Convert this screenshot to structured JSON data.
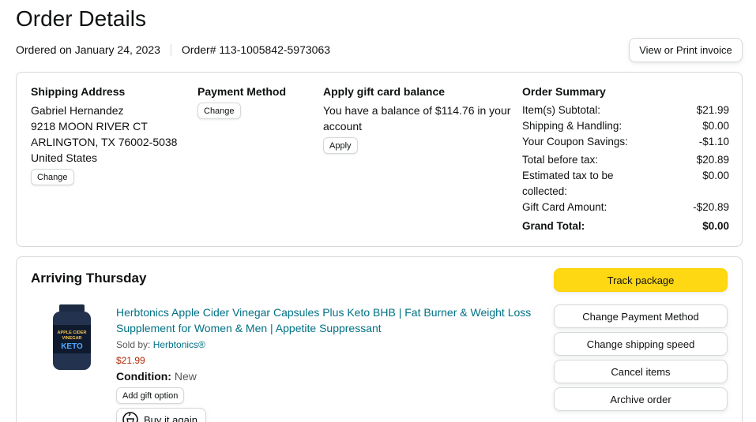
{
  "header": {
    "title": "Order Details",
    "ordered_on": "Ordered on January 24, 2023",
    "order_number": "Order# 113-1005842-5973063",
    "invoice_button": "View or Print invoice"
  },
  "shipping": {
    "heading": "Shipping Address",
    "lines": [
      "Gabriel Hernandez",
      "9218 MOON RIVER CT",
      "ARLINGTON, TX 76002-5038",
      "United States"
    ],
    "change_label": "Change"
  },
  "payment": {
    "heading": "Payment Method",
    "change_label": "Change"
  },
  "gift_card": {
    "heading": "Apply gift card balance",
    "text_line1": "You have a balance of $114.76 in your",
    "text_line2": "account",
    "apply_label": "Apply"
  },
  "summary": {
    "heading": "Order Summary",
    "rows": [
      {
        "label": "Item(s) Subtotal:",
        "value": "$21.99"
      },
      {
        "label": "Shipping & Handling:",
        "value": "$0.00"
      },
      {
        "label": "Your Coupon Savings:",
        "value": "-$1.10"
      },
      {
        "label": "Total before tax:",
        "value": "$20.89"
      },
      {
        "label": "Estimated tax to be collected:",
        "value": "$0.00"
      },
      {
        "label": "Gift Card Amount:",
        "value": "-$20.89"
      }
    ],
    "grand_label": "Grand Total:",
    "grand_value": "$0.00"
  },
  "shipment": {
    "status": "Arriving Thursday",
    "product": {
      "title": "Herbtonics Apple Cider Vinegar Capsules Plus Keto BHB | Fat Burner & Weight Loss Supplement for Women & Men | Appetite Suppressant",
      "sold_by_label": "Sold by:",
      "seller": "Herbtonics®",
      "price": "$21.99",
      "condition_label": "Condition:",
      "condition_value": "New",
      "image_text_1": "APPLE CIDER",
      "image_text_2": "VINEGAR",
      "image_text_3": "KETO"
    },
    "gift_option_label": "Add gift option",
    "buy_again_label": "Buy it again",
    "actions": {
      "track": "Track package",
      "change_payment": "Change Payment Method",
      "change_speed": "Change shipping speed",
      "cancel": "Cancel items",
      "archive": "Archive order"
    }
  },
  "colors": {
    "link": "#007185",
    "price": "#b12704",
    "primary_button": "#ffd814",
    "border": "#d5d9d9"
  }
}
